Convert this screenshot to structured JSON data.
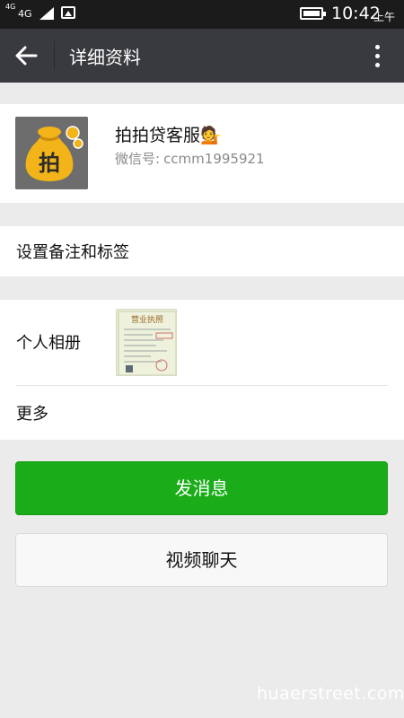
{
  "status_bar": {
    "signal_small": "4G",
    "network": "4G",
    "time": "10:42",
    "ampm": "上午"
  },
  "title_bar": {
    "title": "详细资料",
    "background": "#393a3f"
  },
  "profile": {
    "nickname": "拍拍贷客服",
    "emoji": "💁",
    "wechat_id_label": "微信号:",
    "wechat_id_value": "ccmm1995921",
    "avatar_text": "拍"
  },
  "rows": {
    "remark": "设置备注和标签",
    "album": "个人相册",
    "more": "更多"
  },
  "album_thumb": {
    "title": "营业执照"
  },
  "buttons": {
    "send_message": "发消息",
    "video_call": "视频聊天",
    "primary_color": "#1aad19"
  },
  "watermark": "huaerstreet.com"
}
